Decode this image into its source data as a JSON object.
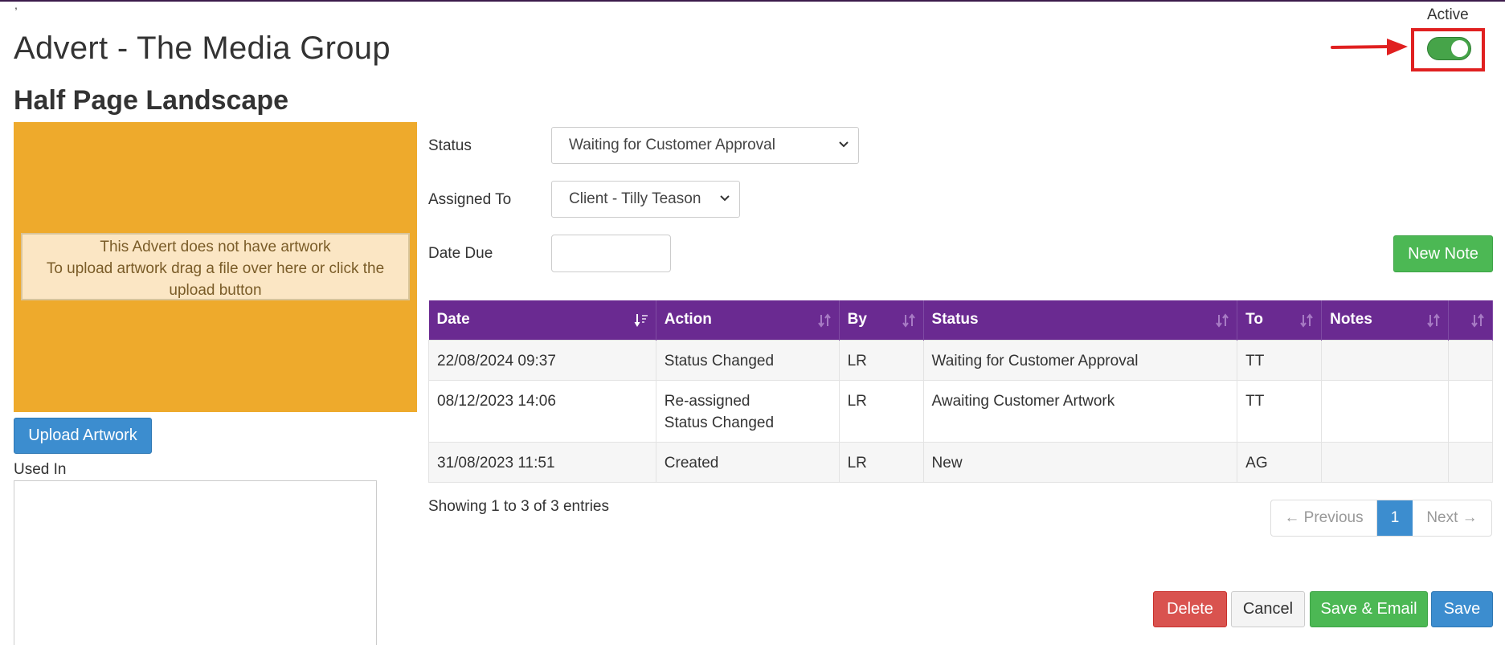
{
  "page": {
    "title": "Advert - The Media Group",
    "subtitle": "Half Page Landscape",
    "tick_mark": ","
  },
  "active_toggle": {
    "label": "Active",
    "on": true,
    "color": "#46a449",
    "highlight_color": "#e02020"
  },
  "artwork": {
    "background_color": "#eeaa2c",
    "message_line1": "This Advert does not have artwork",
    "message_line2": "To upload artwork drag a file over here or click the upload button",
    "upload_label": "Upload Artwork"
  },
  "used_in": {
    "label": "Used In"
  },
  "form": {
    "status_label": "Status",
    "status_value": "Waiting for Customer Approval",
    "assigned_label": "Assigned To",
    "assigned_value": "Client - Tilly Teason",
    "date_due_label": "Date Due",
    "date_due_value": "",
    "new_note_label": "New Note"
  },
  "notes_table": {
    "header_color": "#6a2a91",
    "columns": [
      "Date",
      "Action",
      "By",
      "Status",
      "To",
      "Notes",
      ""
    ],
    "rows": [
      {
        "date": "22/08/2024 09:37",
        "action1": "Status Changed",
        "action2": "",
        "by": "LR",
        "status": "Waiting for Customer Approval",
        "to": "TT",
        "notes": ""
      },
      {
        "date": "08/12/2023 14:06",
        "action1": "Re-assigned",
        "action2": "Status Changed",
        "by": "LR",
        "status": "Awaiting Customer Artwork",
        "to": "TT",
        "notes": ""
      },
      {
        "date": "31/08/2023 11:51",
        "action1": "Created",
        "action2": "",
        "by": "LR",
        "status": "New",
        "to": "AG",
        "notes": ""
      }
    ],
    "showing_text": "Showing 1 to 3 of 3 entries"
  },
  "pagination": {
    "prev_label": "← Previous",
    "current_page": "1",
    "next_label": "Next →"
  },
  "footer_buttons": {
    "delete_label": "Delete",
    "cancel_label": "Cancel",
    "save_email_label": "Save & Email",
    "save_label": "Save"
  }
}
